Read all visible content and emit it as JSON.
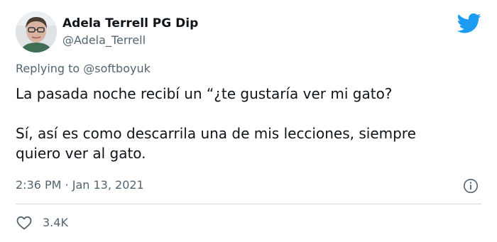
{
  "author": {
    "display_name": "Adela Terrell PG Dip",
    "handle": "@Adela_Terrell",
    "avatar_icon": "person-avatar"
  },
  "brand": {
    "icon": "twitter-bird-icon",
    "color": "#1d9bf0"
  },
  "reply": {
    "text": "Replying to @softboyuk"
  },
  "tweet": {
    "line1": "La pasada noche recibí un “¿te gustaría ver mi gato?",
    "line2": "Sí, así es como descarrila una de mis lecciones, siempre",
    "line3": "quiero ver al gato."
  },
  "meta": {
    "timestamp": "2:36 PM · Jan 13, 2021",
    "info_icon": "info-icon"
  },
  "actions": {
    "like_icon": "heart-icon",
    "like_count": "3.4K"
  },
  "colors": {
    "text_primary": "#0f1419",
    "text_secondary": "#536471",
    "divider": "#cfd9de"
  }
}
